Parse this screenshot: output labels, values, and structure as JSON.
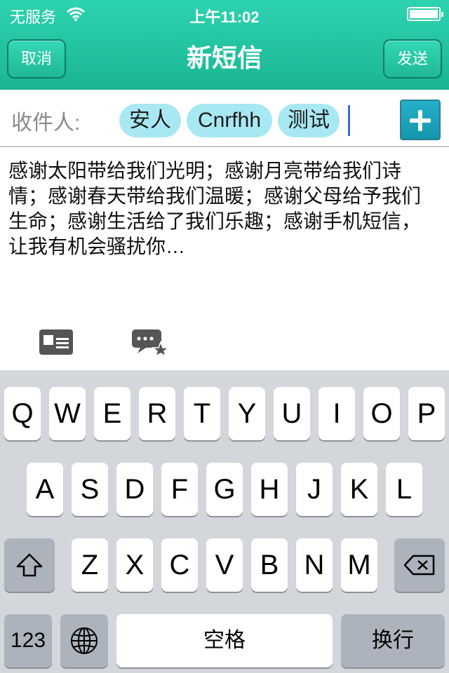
{
  "status_bar": {
    "carrier": "无服务",
    "time": "上午11:02"
  },
  "nav": {
    "cancel_label": "取消",
    "title": "新短信",
    "send_label": "发送"
  },
  "recipients": {
    "label": "收件人:",
    "chips": [
      "安人",
      "Cnrfhh",
      "测试"
    ]
  },
  "message": {
    "text": "感谢太阳带给我们光明；感谢月亮带给我们诗情；感谢春天带给我们温暖；感谢父母给予我们生命；感谢生活给了我们乐趣；感谢手机短信，让我有机会骚扰你…"
  },
  "toolbar": {
    "icons": [
      "contact-card-icon",
      "message-template-icon"
    ]
  },
  "keyboard": {
    "row1": [
      "Q",
      "W",
      "E",
      "R",
      "T",
      "Y",
      "U",
      "I",
      "O",
      "P"
    ],
    "row2": [
      "A",
      "S",
      "D",
      "F",
      "G",
      "H",
      "J",
      "K",
      "L"
    ],
    "row3": [
      "Z",
      "X",
      "C",
      "V",
      "B",
      "N",
      "M"
    ],
    "numbers_label": "123",
    "space_label": "空格",
    "return_label": "换行"
  },
  "colors": {
    "accent": "#1ab592",
    "chip": "#a8e8f2",
    "add_button": "#1596ae"
  }
}
